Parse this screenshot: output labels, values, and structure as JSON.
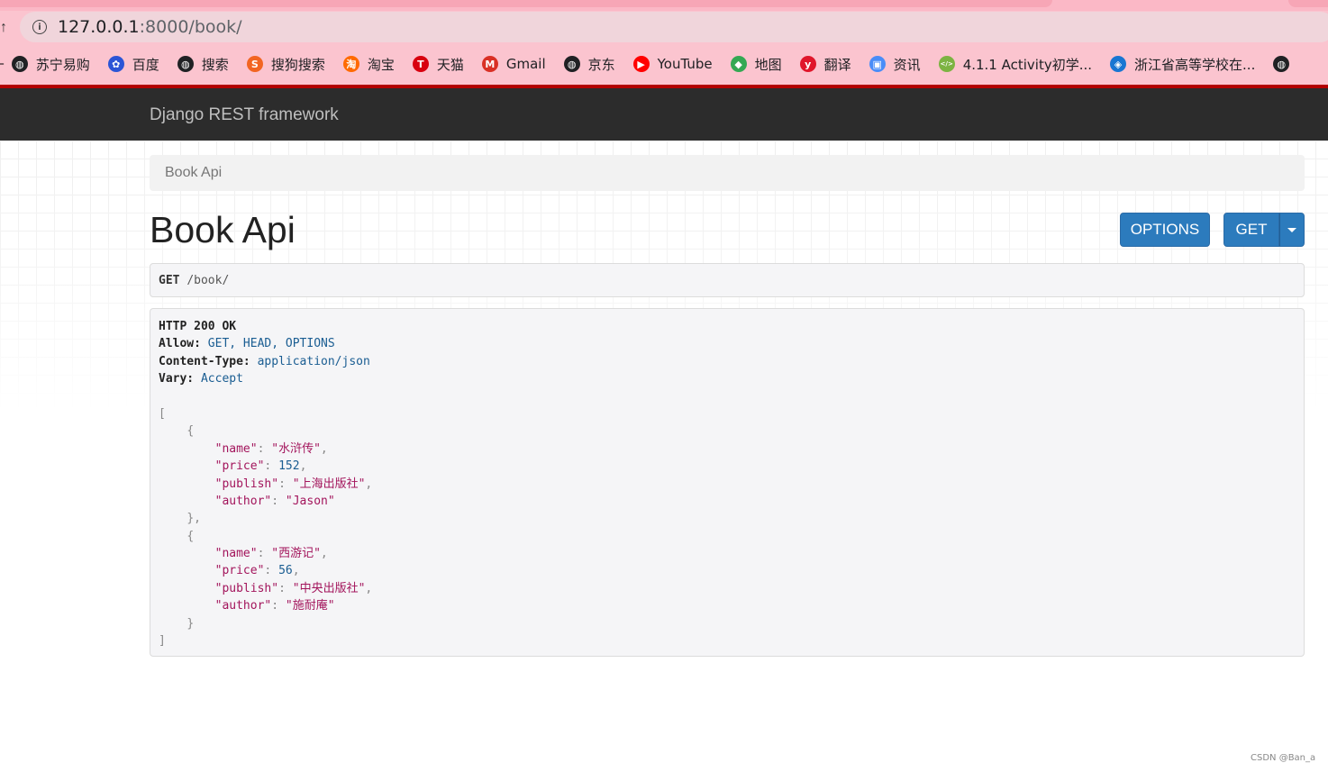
{
  "browser": {
    "url_host": "127.0.0.1",
    "url_path": ":8000/book/",
    "bookmarks": [
      {
        "label": "苏宁易购",
        "icon": "globe-icon",
        "color": "#202124"
      },
      {
        "label": "百度",
        "icon": "baidu-paw-icon",
        "color": "#2b55d6"
      },
      {
        "label": "搜索",
        "icon": "globe-icon",
        "color": "#202124"
      },
      {
        "label": "搜狗搜索",
        "icon": "sogou-icon",
        "color": "#f26522"
      },
      {
        "label": "淘宝",
        "icon": "taobao-icon",
        "color": "#ff6a00"
      },
      {
        "label": "天猫",
        "icon": "tmall-icon",
        "color": "#d8000f"
      },
      {
        "label": "Gmail",
        "icon": "gmail-icon",
        "color": "#d93025"
      },
      {
        "label": "京东",
        "icon": "globe-icon",
        "color": "#202124"
      },
      {
        "label": "YouTube",
        "icon": "youtube-icon",
        "color": "#ff0000"
      },
      {
        "label": "地图",
        "icon": "maps-icon",
        "color": "#34a853"
      },
      {
        "label": "翻译",
        "icon": "youdao-icon",
        "color": "#e0162b"
      },
      {
        "label": "资讯",
        "icon": "news-icon",
        "color": "#4a8df8"
      },
      {
        "label": "4.1.1 Activity初学...",
        "icon": "code-icon",
        "color": "#7cb342"
      },
      {
        "label": "浙江省高等学校在...",
        "icon": "school-icon",
        "color": "#1976d2"
      }
    ]
  },
  "navbar": {
    "brand": "Django REST framework"
  },
  "breadcrumb": "Book Api",
  "title": "Book Api",
  "buttons": {
    "options": "OPTIONS",
    "get": "GET"
  },
  "request": {
    "method": "GET",
    "path": "/book/"
  },
  "response": {
    "status": "HTTP 200 OK",
    "headers": [
      {
        "key": "Allow:",
        "value": "GET, HEAD, OPTIONS"
      },
      {
        "key": "Content-Type:",
        "value": "application/json"
      },
      {
        "key": "Vary:",
        "value": "Accept"
      }
    ],
    "books": [
      {
        "name": "水浒传",
        "price": 152,
        "publish": "上海出版社",
        "author": "Jason"
      },
      {
        "name": "西游记",
        "price": 56,
        "publish": "中央出版社",
        "author": "施耐庵"
      }
    ]
  },
  "watermark": "CSDN @Ban_a"
}
